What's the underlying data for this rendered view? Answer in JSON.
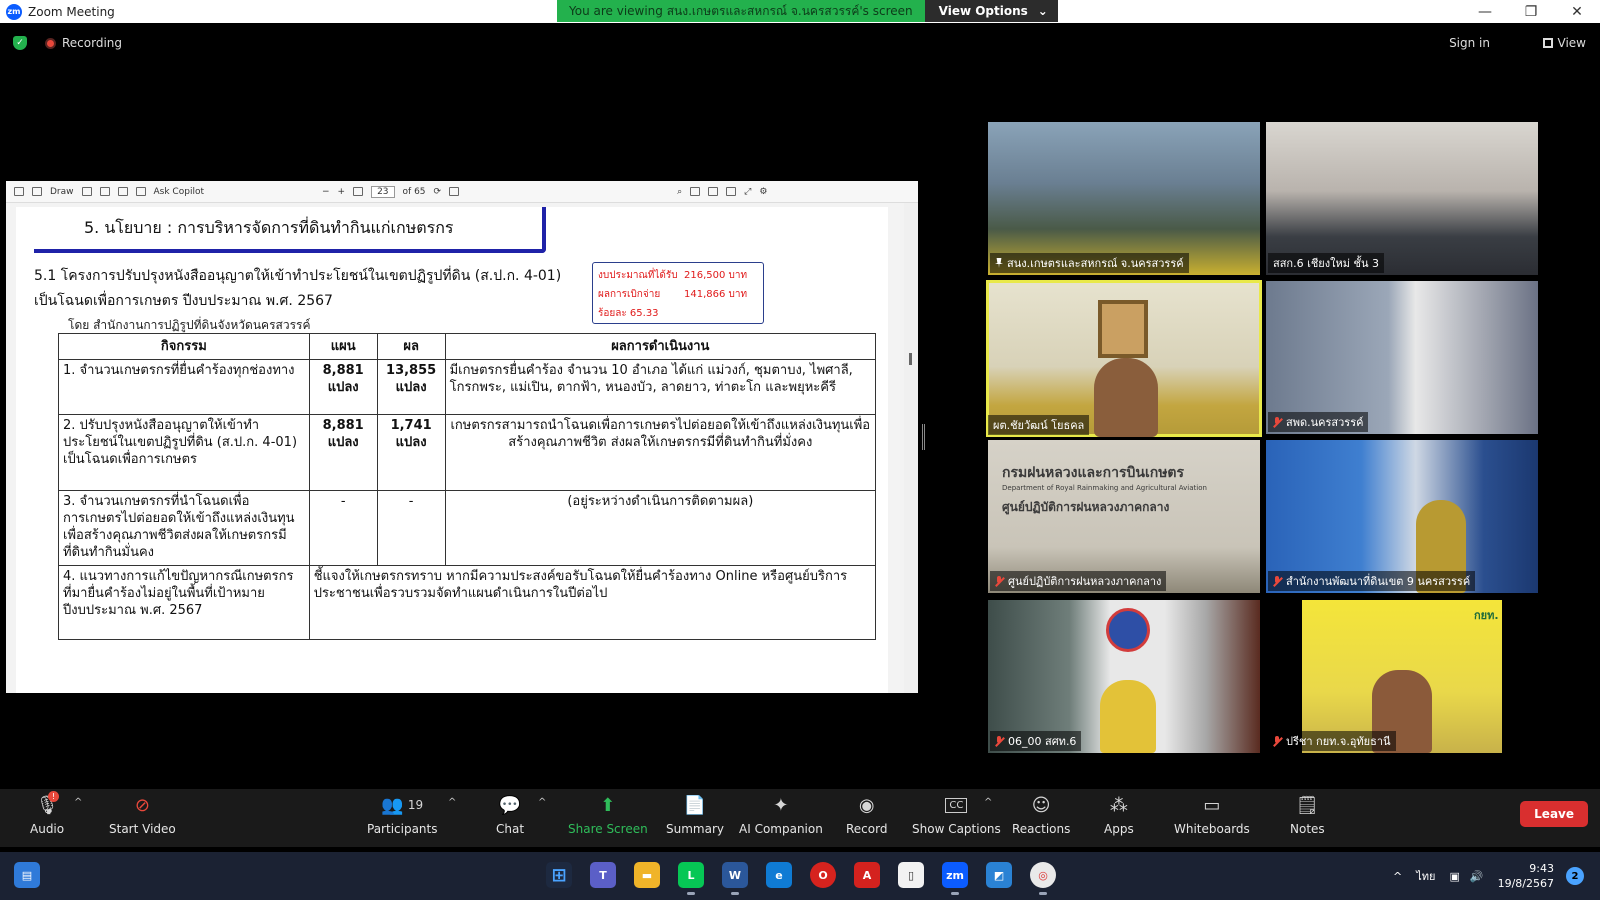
{
  "window": {
    "title": "Zoom Meeting",
    "logo_text": "zm",
    "controls": [
      "—",
      "❐",
      "✕"
    ]
  },
  "share_banner": {
    "message": "You are viewing สนง.เกษตรและสหกรณ์ จ.นครสวรรค์'s screen",
    "options_label": "View Options"
  },
  "top_bar": {
    "recording_label": "Recording",
    "sign_in": "Sign in",
    "view_label": "View"
  },
  "pdf_viewer": {
    "draw_label": "Draw",
    "copilot_label": "Ask Copilot",
    "page_current": "23",
    "page_total": "of 65"
  },
  "slide": {
    "title": "5. นโยบาย : การบริหารจัดการที่ดินทำกินแก่เกษตรกร",
    "subtitle_line1": "5.1 โครงการปรับปรุงหนังสืออนุญาตให้เข้าทำประโยชน์ในเขตปฏิรูปที่ดิน (ส.ป.ก. 4-01)",
    "subtitle_line2": "เป็นโฉนดเพื่อการเกษตร ปีงบประมาณ พ.ศ. 2567",
    "by_line": "โดย สำนักงานการปฏิรูปที่ดินจังหวัดนครสวรรค์",
    "budget": {
      "received_label": "งบประมาณที่ได้รับ",
      "received_value": "216,500 บาท",
      "spent_label": "ผลการเบิกจ่าย",
      "spent_value": "141,866 บาท",
      "percent": "ร้อยละ 65.33"
    },
    "table": {
      "headers": [
        "กิจกรรม",
        "แผน",
        "ผล",
        "ผลการดำเนินงาน"
      ],
      "rows": [
        {
          "activity": "1. จำนวนเกษตรกรที่ยื่นคำร้องทุกช่องทาง",
          "plan": "8,881 แปลง",
          "result": "13,855 แปลง",
          "outcome": "มีเกษตรกรยื่นคำร้อง จำนวน 10 อำเภอ ได้แก่ แม่วงก์, ชุมตาบง, ไพศาลี, โกรกพระ, แม่เปิน, ตากฟ้า, หนองบัว, ลาดยาว, ท่าตะโก และพยุหะคีรี"
        },
        {
          "activity": "2. ปรับปรุงหนังสืออนุญาตให้เข้าทำประโยชน์ในเขตปฏิรูปที่ดิน (ส.ป.ก. 4-01) เป็นโฉนดเพื่อการเกษตร",
          "plan": "8,881 แปลง",
          "result": "1,741 แปลง",
          "outcome": "เกษตรกรสามารถนำโฉนดเพื่อการเกษตรไปต่อยอดให้เข้าถึงแหล่งเงินทุนเพื่อสร้างคุณภาพชีวิต ส่งผลให้เกษตรกรมีที่ดินทำกินที่มั่งคง"
        },
        {
          "activity": "3. จำนวนเกษตรกรที่นำโฉนดเพื่อการเกษตรไปต่อยอดให้เข้าถึงแหล่งเงินทุนเพื่อสร้างคุณภาพชีวิตส่งผลให้เกษตรกรมีที่ดินทำกินมั่นคง",
          "plan": "-",
          "result": "-",
          "outcome": "(อยู่ระหว่างดำเนินการติดตามผล)"
        }
      ],
      "row4_activity": "4. แนวทางการแก้ไขปัญหากรณีเกษตรกรที่มายื่นคำร้องไม่อยู่ในพื้นที่เป้าหมายปีงบประมาณ พ.ศ. 2567",
      "row4_outcome": "ชี้แจงให้เกษตรกรทราบ หากมีความประสงค์ขอรับโฉนดให้ยื่นคำร้องทาง Online หรือศูนย์บริการประชาชนเพื่อรวบรวมจัดทำแผนดำเนินการในปีต่อไป"
    }
  },
  "participants_tiles": [
    {
      "name": "สนง.เกษตรและสหกรณ์ จ.นครสวรรค์",
      "muted": false,
      "pinned": true
    },
    {
      "name": "สสก.6 เชียงใหม่ ชั้น 3",
      "muted": false,
      "pinned": false
    },
    {
      "name": "ผต.ชัยวัฒน์ โยธคล",
      "muted": false,
      "pinned": false
    },
    {
      "name": "สพด.นครสวรรค์",
      "muted": true,
      "pinned": false
    },
    {
      "name": "ศูนย์ปฏิบัติการฝนหลวงภาคกลาง",
      "muted": true,
      "pinned": false
    },
    {
      "name": "สำนักงานพัฒนาที่ดินเขต 9 นครสวรรค์",
      "muted": true,
      "pinned": false
    },
    {
      "name": "06_00 สศท.6",
      "muted": true,
      "pinned": false
    },
    {
      "name": "ปรีชา กยท.จ.อุทัยธานี",
      "muted": true,
      "pinned": false
    }
  ],
  "tile_signs": {
    "rainmaking_th": "กรมฝนหลวงและการบินเกษตร",
    "rainmaking_en": "Department of Royal Rainmaking and Agricultural Aviation",
    "rainmaking_center": "ศูนย์ปฏิบัติการฝนหลวงภาคกลาง",
    "rubber_logo": "กยท."
  },
  "controls": {
    "audio": "Audio",
    "start_video": "Start Video",
    "participants": "Participants",
    "participant_count": "19",
    "chat": "Chat",
    "share_screen": "Share Screen",
    "summary": "Summary",
    "ai_companion": "AI Companion",
    "record": "Record",
    "show_captions": "Show Captions",
    "captions_icon": "CC",
    "reactions": "Reactions",
    "apps": "Apps",
    "whiteboards": "Whiteboards",
    "notes": "Notes",
    "leave": "Leave",
    "audio_badge": "!"
  },
  "taskbar": {
    "lang": "ไทย",
    "time": "9:43",
    "date": "19/8/2567",
    "notifications": "2",
    "apps": [
      "windows",
      "teams",
      "explorer",
      "line",
      "word",
      "edge",
      "opera",
      "acrobat",
      "file",
      "zoom",
      "photos",
      "chrome"
    ]
  },
  "colors": {
    "share_green": "#23b14d",
    "leave_red": "#d92f2f",
    "active_speaker": "#e9e94a",
    "slide_blue": "#1f22a8",
    "budget_red": "#e01a1a"
  }
}
